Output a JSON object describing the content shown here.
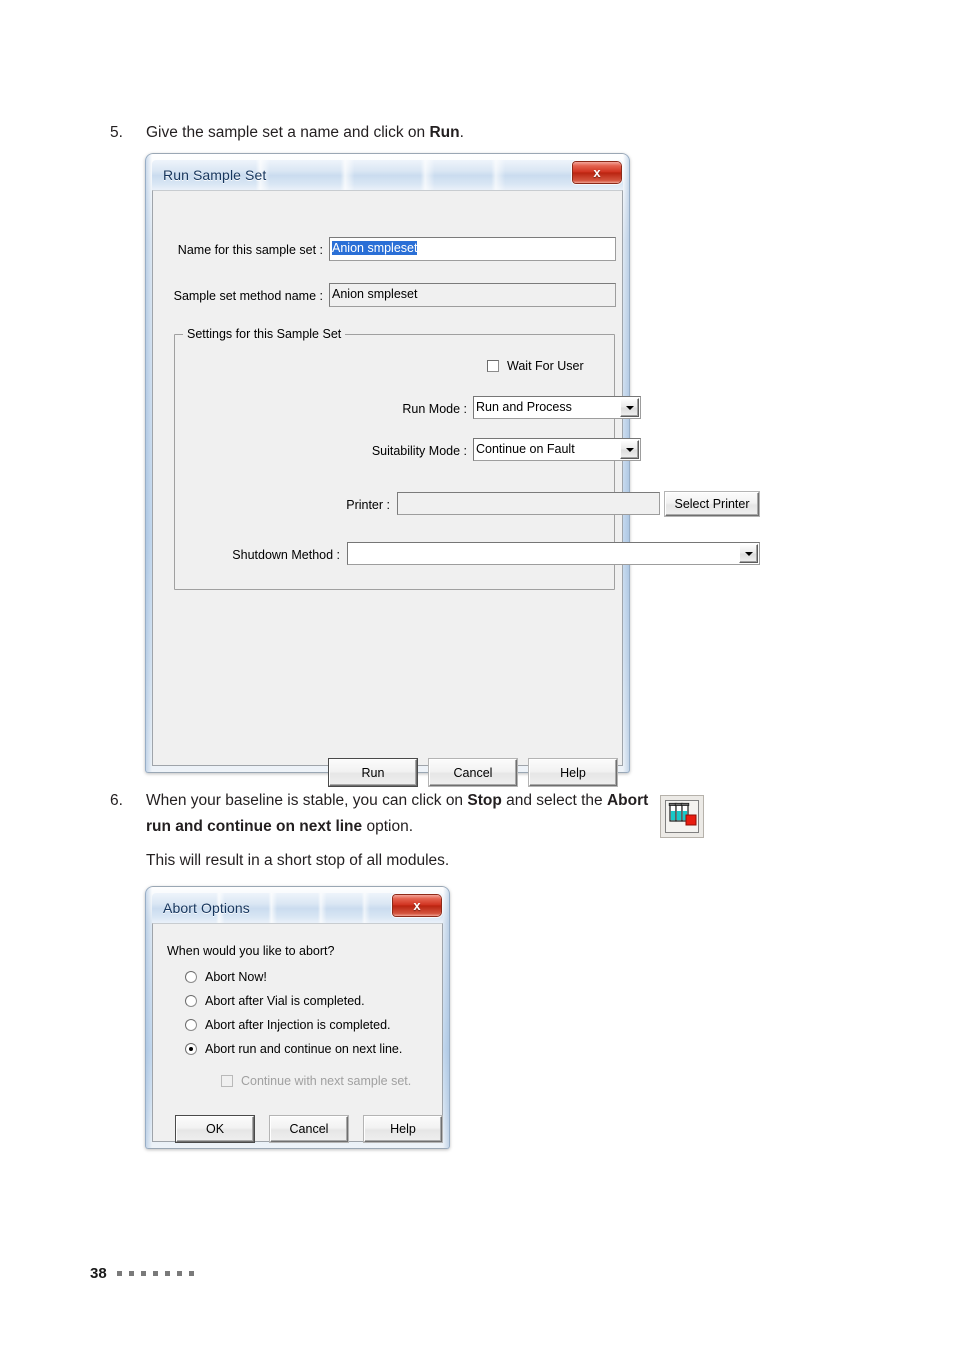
{
  "page": {
    "number": "38",
    "footer_dot_count": 7
  },
  "steps": [
    {
      "number": "5.",
      "text_before": "Give the sample set a name and click on ",
      "bold": "Run",
      "text_after": "."
    }
  ],
  "step6": {
    "number": "6.",
    "line1_before": "When your baseline is stable, you can click on ",
    "line1_bold": "Stop",
    "line1_after": " and select the ",
    "line2_bold": "Abort run and continue on next line",
    "line2_after": " option.",
    "paragraph": "This will result in a short stop of all modules.",
    "icon_name": "stop-vials-icon"
  },
  "run_sample_set_dialog": {
    "title": "Run Sample Set",
    "close_label": "x",
    "fields": {
      "name_label": "Name for this sample set :",
      "name_value": "Anion smpleset",
      "method_label": "Sample set method name :",
      "method_value": "Anion smpleset"
    },
    "settings_group": {
      "title": "Settings for this Sample Set",
      "wait_for_user_label": "Wait For User",
      "wait_for_user_checked": false,
      "run_mode_label": "Run Mode :",
      "run_mode_value": "Run and Process",
      "suitability_mode_label": "Suitability Mode :",
      "suitability_mode_value": "Continue on Fault",
      "printer_label": "Printer :",
      "printer_value": "",
      "select_printer_label": "Select Printer",
      "shutdown_method_label": "Shutdown Method :",
      "shutdown_method_value": ""
    },
    "buttons": {
      "run": "Run",
      "cancel": "Cancel",
      "help": "Help"
    }
  },
  "abort_options_dialog": {
    "title": "Abort Options",
    "close_label": "x",
    "question": "When would you like to abort?",
    "options": [
      {
        "label": "Abort Now!",
        "checked": false
      },
      {
        "label": "Abort after Vial is completed.",
        "checked": false
      },
      {
        "label": "Abort after Injection is completed.",
        "checked": false
      },
      {
        "label": "Abort run and continue on next line.",
        "checked": true
      }
    ],
    "sub_checkbox": {
      "label": "Continue with next sample set.",
      "checked": false,
      "disabled": true
    },
    "buttons": {
      "ok": "OK",
      "cancel": "Cancel",
      "help": "Help"
    }
  },
  "colors": {
    "accent_blue": "#2a6fd6",
    "title_text": "#17365d",
    "close_red": "#cf2f1c",
    "icon_liquid": "#19c8c8",
    "icon_stop": "#e81c0f"
  }
}
